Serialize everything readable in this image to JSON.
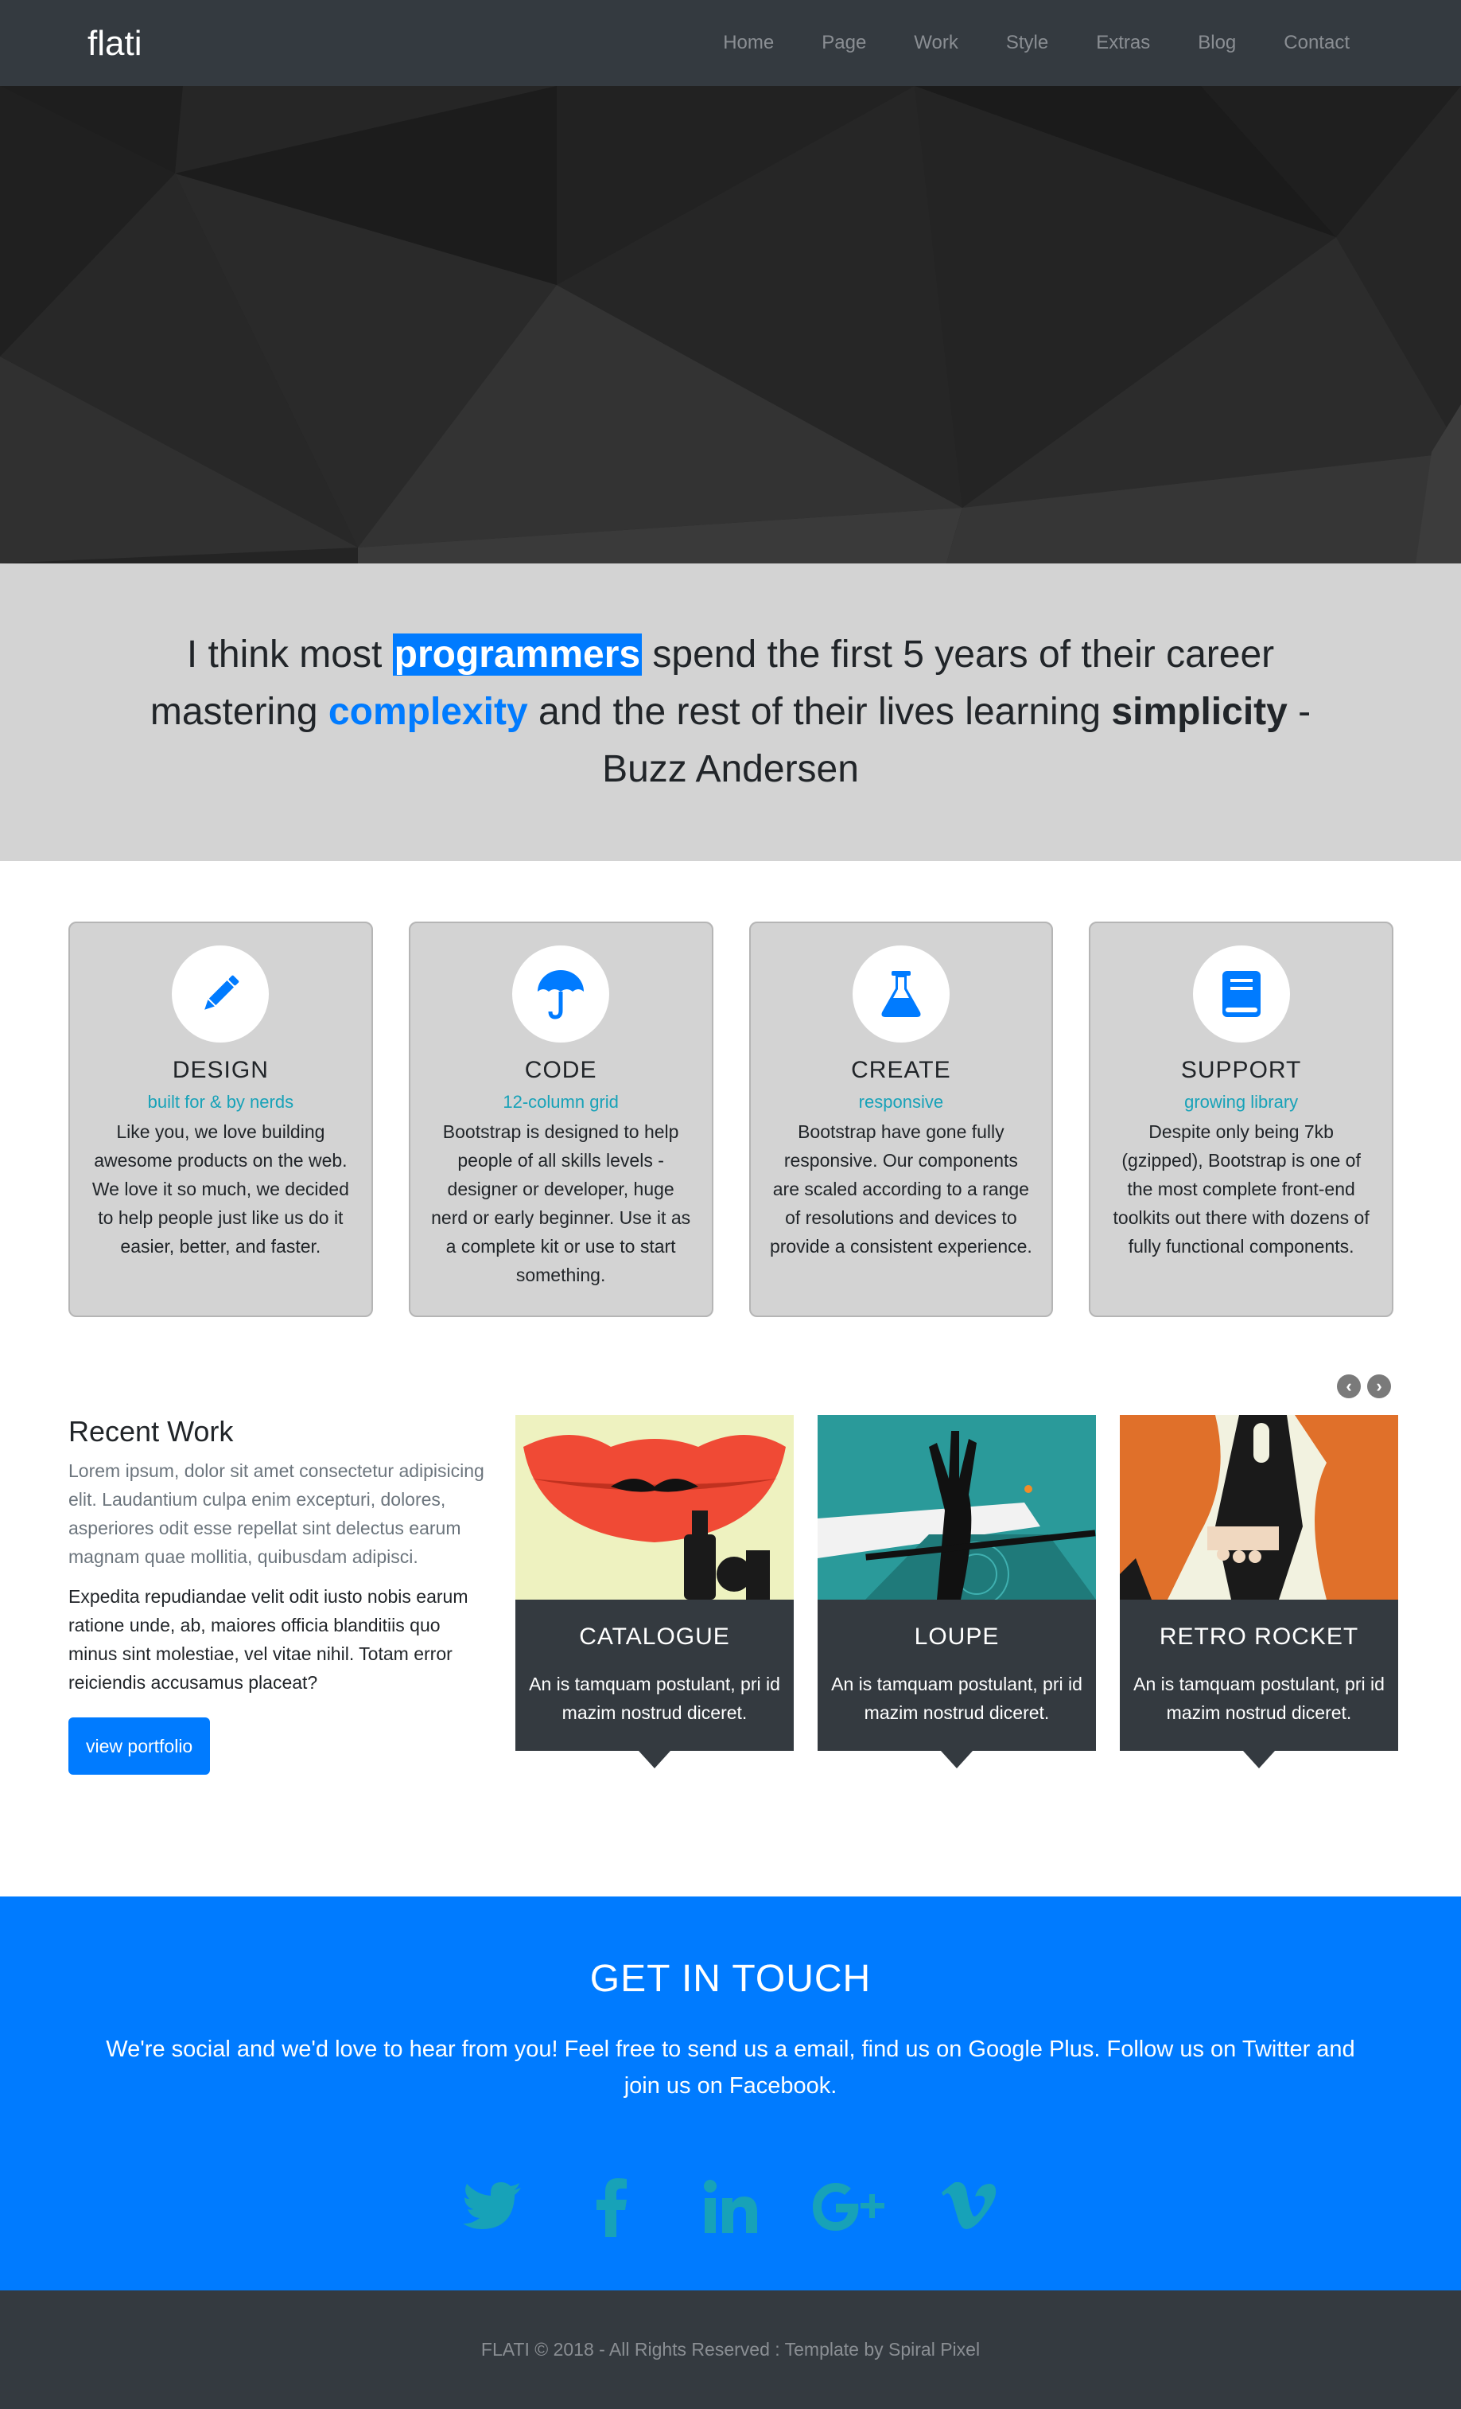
{
  "navbar": {
    "brand": "flati",
    "items": [
      "Home",
      "Page",
      "Work",
      "Style",
      "Extras",
      "Blog",
      "Contact"
    ]
  },
  "quote": {
    "part1": "I think most ",
    "highlight": "programmers",
    "part2": " spend the first 5 years of their career mastering ",
    "blue": "complexity",
    "part3": " and the rest of their lives learning ",
    "bold": "simplicity",
    "part4": " - Buzz Andersen"
  },
  "features": [
    {
      "icon": "pencil-icon",
      "title": "DESIGN",
      "subtitle": "built for & by nerds",
      "text": "Like you, we love building awesome products on the web. We love it so much, we decided to help people just like us do it easier, better, and faster."
    },
    {
      "icon": "umbrella-icon",
      "title": "CODE",
      "subtitle": "12-column grid",
      "text": "Bootstrap is designed to help people of all skills levels - designer or developer, huge nerd or early beginner. Use it as a complete kit or use to start something."
    },
    {
      "icon": "flask-icon",
      "title": "CREATE",
      "subtitle": "responsive",
      "text": "Bootstrap have gone fully responsive. Our components are scaled according to a range of resolutions and devices to provide a consistent experience."
    },
    {
      "icon": "book-icon",
      "title": "SUPPORT",
      "subtitle": "growing library",
      "text": "Despite only being 7kb (gzipped), Bootstrap is one of the most complete front-end toolkits out there with dozens of fully functional components."
    }
  ],
  "recent_work": {
    "title": "Recent Work",
    "p1": "Lorem ipsum, dolor sit amet consectetur adipisicing elit. Laudantium culpa enim excepturi, dolores, asperiores odit esse repellat sint delectus earum magnam quae mollitia, quibusdam adipisci.",
    "p2": "Expedita repudiandae velit odit iusto nobis earum ratione unde, ab, maiores officia blanditiis quo minus sint molestiae, vel vitae nihil. Totam error reiciendis accusamus placeat?",
    "button": "view portfolio",
    "items": [
      {
        "title": "CATALOGUE",
        "text": "An is tamquam postulant, pri id mazim nostrud diceret."
      },
      {
        "title": "LOUPE",
        "text": "An is tamquam postulant, pri id mazim nostrud diceret."
      },
      {
        "title": "RETRO ROCKET",
        "text": "An is tamquam postulant, pri id mazim nostrud diceret."
      }
    ]
  },
  "contact": {
    "title": "GET IN TOUCH",
    "text": "We're social and we'd love to hear from you! Feel free to send us a email, find us on Google Plus. Follow us on Twitter and join us on Facebook.",
    "socials": [
      "twitter-icon",
      "facebook-icon",
      "linkedin-icon",
      "google-plus-icon",
      "vimeo-icon"
    ]
  },
  "footer": {
    "text": "FLATI © 2018 - All Rights Reserved : Template by Spiral Pixel"
  },
  "colors": {
    "accent": "#007bff",
    "dark": "#343a40",
    "teal": "#17a2b8",
    "panel": "#d3d3d3"
  }
}
